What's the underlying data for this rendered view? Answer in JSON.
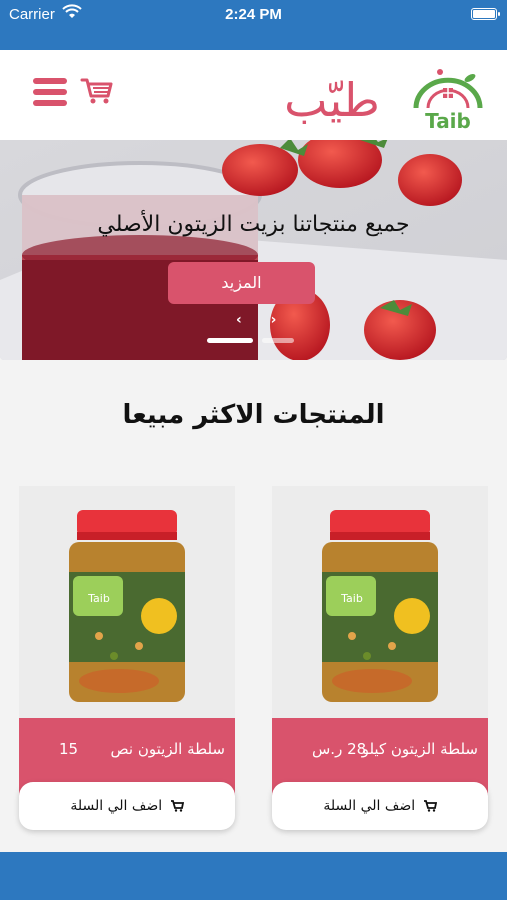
{
  "status_bar": {
    "carrier": "Carrier",
    "time": "2:24 PM"
  },
  "header": {
    "logo_arabic": "طيّب",
    "logo_latin": "Taib"
  },
  "hero": {
    "title": "جميع منتجاتنا بزيت الزيتون الأصلي",
    "button_label": "المزيد",
    "arrows": "‹ ›"
  },
  "section": {
    "title": "المنتجات الاكثر مبيعا"
  },
  "products": [
    {
      "name": "سلطة الزيتون كيلو",
      "price": "28 ر.س",
      "add_label": "اضف الي السلة"
    },
    {
      "name": "سلطة الزيتون نص",
      "price": "15",
      "add_label": "اضف الي السلة"
    }
  ],
  "colors": {
    "brand_blue": "#2d78bf",
    "accent_pink": "#d9536c",
    "logo_green": "#5aa84a"
  }
}
